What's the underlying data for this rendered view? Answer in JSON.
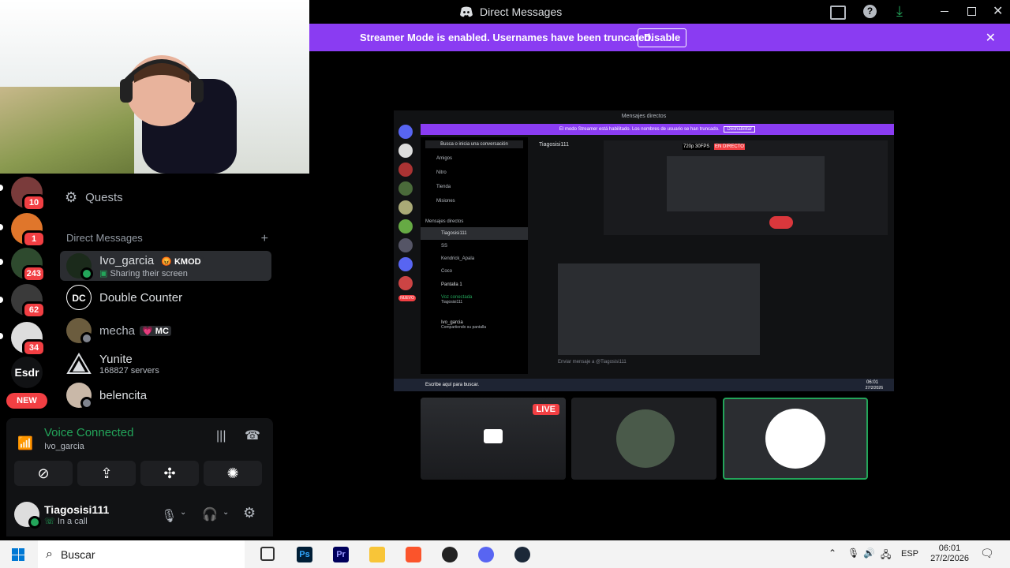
{
  "window": {
    "title": "Direct Messages"
  },
  "banner": {
    "message": "Streamer Mode is enabled. Usernames have been truncated.",
    "button": "Disable"
  },
  "servers": [
    {
      "badge": "10",
      "color": "#7a3b3b"
    },
    {
      "badge": "1",
      "color": "#e0762b"
    },
    {
      "badge": "243",
      "color": "#2e4a2e"
    },
    {
      "badge": "62",
      "color": "#3a3a3a"
    },
    {
      "badge": "34",
      "color": "#dddddd"
    }
  ],
  "server_esdr": "Esdr",
  "new_label": "NEW",
  "quests": "Quests",
  "dm_header": "Direct Messages",
  "dms": [
    {
      "name": "Ivo_garcia",
      "tag": "KMOD",
      "sub": "Sharing their screen"
    },
    {
      "name": "Double Counter",
      "tag": "",
      "sub": ""
    },
    {
      "name": "mecha",
      "tag": "MC",
      "sub": ""
    },
    {
      "name": "Yunite",
      "tag": "",
      "sub": "168827 servers"
    },
    {
      "name": "belencita",
      "tag": "",
      "sub": ""
    }
  ],
  "voice": {
    "status": "Voice Connected",
    "channel": "Ivo_garcia"
  },
  "user": {
    "name": "Tiagosisi111",
    "status": "In a call"
  },
  "stream": {
    "live": "LIVE",
    "inner": {
      "title": "Mensajes directos",
      "banner": "El modo Streamer está habilitado. Los nombres de usuario se han truncado.",
      "banner_btn": "Deshabilitar",
      "search": "Busca o inicia una conversación",
      "menu": [
        "Amigos",
        "Nitro",
        "Tienda",
        "Misiones"
      ],
      "dm_header": "Mensajes directos",
      "dms": [
        "Tiagosisi111",
        "SS",
        "Kendrick_Apala",
        "Coco"
      ],
      "screen": "Pantalla 1",
      "voice": "Voz conectada",
      "voice_sub": "Tiagosisi111",
      "user": "Ivo_garcia",
      "user_sub": "Compartiendo su pantalla",
      "chat_user": "Tiagosisi111",
      "quality": "720p 30FPS",
      "live": "EN DIRECTO",
      "chat_placeholder": "Enviar mensaje a @Tiagosisi111",
      "taskbar_search": "Escribe aquí para buscar.",
      "time": "06:01",
      "date": "27/2/2026",
      "new_badge": "NUEVO"
    }
  },
  "taskbar": {
    "search": "Buscar",
    "lang": "ESP",
    "time": "06:01",
    "date": "27/2/2026"
  }
}
